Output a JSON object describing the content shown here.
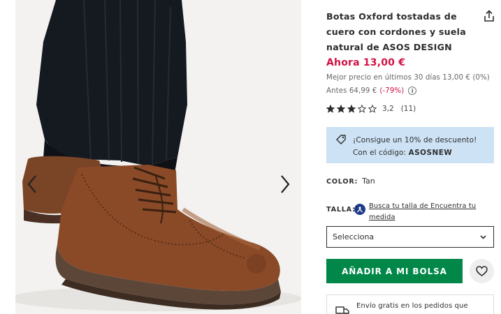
{
  "gallery": {
    "prev_icon": "chevron-left-icon",
    "next_icon": "chevron-right-icon"
  },
  "product": {
    "title": "Botas Oxford tostadas de cuero con cordones y suela natural de ASOS DESIGN",
    "share_icon": "share-icon",
    "price_now": "Ahora 13,00 €",
    "price_best": "Mejor precio en últimos 30 días 13,00 € (0%)",
    "price_before": "Antes 64,99 €",
    "price_discount": "(-79%)",
    "info_icon": "info-icon"
  },
  "rating": {
    "stars_value": 3.2,
    "stars_max": 5,
    "value_text": "3,2",
    "count_text": "(11)"
  },
  "promo": {
    "icon": "price-tag-icon",
    "text": "¡Consigue un 10% de descuento! Con el código: ",
    "code": "ASOSNEW"
  },
  "color": {
    "label": "COLOR:",
    "value": "Tan"
  },
  "size": {
    "label": "TALLA:",
    "fit_icon": "fit-assistant-icon",
    "fit_link": "Busca tu talla de Encuentra tu medida",
    "select_value": "Selecciona",
    "chevron_icon": "chevron-down-icon"
  },
  "actions": {
    "add_to_bag": "AÑADIR A MI BOLSA",
    "wishlist_icon": "heart-icon"
  },
  "delivery": {
    "icon": "truck-icon",
    "text": "Envío gratis en los pedidos que"
  },
  "colors": {
    "price_red": "#d01345",
    "button_green": "#018849",
    "promo_blue": "#cde2f5"
  }
}
